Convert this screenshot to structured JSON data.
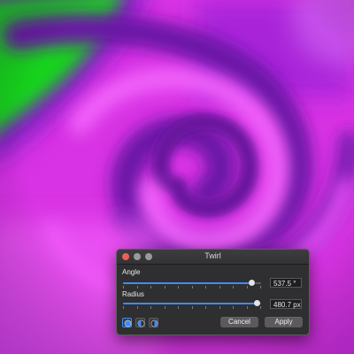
{
  "canvas": {
    "colors": {
      "background": "#d833e4",
      "green": "#14d814",
      "dark_purple": "#6f16a8",
      "magenta": "#f05cf8"
    }
  },
  "dialog": {
    "title": "Twirl",
    "angle": {
      "label": "Angle",
      "value_text": "537.5 °",
      "level": 0.93
    },
    "radius": {
      "label": "Radius",
      "value_text": "480.7 px",
      "level": 0.97
    },
    "mode_buttons": [
      "both-mode-icon",
      "left-half-mode-icon",
      "right-half-mode-icon"
    ],
    "cancel_label": "Cancel",
    "apply_label": "Apply",
    "accent": "#3f8cf2"
  }
}
